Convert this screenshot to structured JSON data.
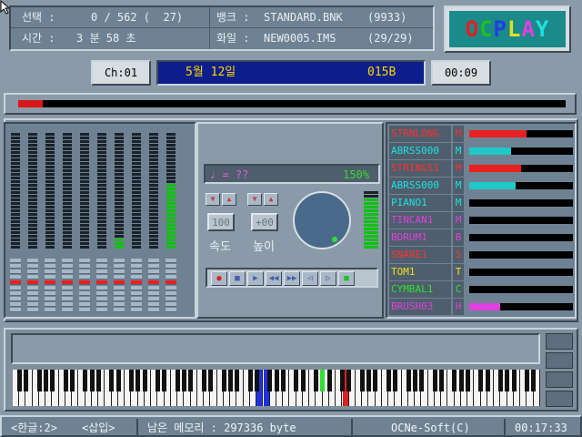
{
  "header": {
    "select_label": "선택 :",
    "select_value": "0 / 562 (  27)",
    "time_label": "시간 :",
    "time_value": "3 분 58 초",
    "bank_label": "뱅크 :",
    "bank_value": "STANDARD.BNK",
    "bank_count": "(9933)",
    "file_label": "화일 :",
    "file_value": "NEW0005.IMS",
    "file_count": "(29/29)"
  },
  "logo": {
    "letters": [
      "O",
      "C",
      "P",
      "L",
      "A",
      "Y"
    ],
    "colors": [
      "#e02020",
      "#20c020",
      "#2040e0",
      "#e0e020",
      "#e040e0",
      "#20e0e0"
    ]
  },
  "channel": "Ch:01",
  "date": "5월 12일",
  "code": "015B",
  "elapsed": "00:09",
  "progress": 0.045,
  "controls": {
    "tempo_display": "♩ = ??",
    "percent": "150%",
    "speed_value": "100",
    "pitch_value": "+00",
    "speed_label": "속도",
    "pitch_label": "높이",
    "dial_level": 0.62
  },
  "instruments": [
    {
      "name": "STRNLONG",
      "flag": "M",
      "name_color": "#ff3030",
      "flag_color": "#ff3030",
      "bar_color": "#e82020",
      "level": 0.55
    },
    {
      "name": "ABRSS000",
      "flag": "M",
      "name_color": "#20e0e0",
      "flag_color": "#20e0e0",
      "bar_color": "#20c8c8",
      "level": 0.4
    },
    {
      "name": "STRINGS1",
      "flag": "M",
      "name_color": "#ff3030",
      "flag_color": "#ff3030",
      "bar_color": "#e82020",
      "level": 0.5
    },
    {
      "name": "ABRSS000",
      "flag": "M",
      "name_color": "#20e0e0",
      "flag_color": "#20e0e0",
      "bar_color": "#20c8c8",
      "level": 0.45
    },
    {
      "name": "PIANO1",
      "flag": "M",
      "name_color": "#20e0e0",
      "flag_color": "#20e0e0",
      "bar_color": "#20c8c8",
      "level": 0
    },
    {
      "name": "TINCAN1",
      "flag": "M",
      "name_color": "#e040e0",
      "flag_color": "#e040e0",
      "bar_color": "#e040e0",
      "level": 0
    },
    {
      "name": "BDRUM1",
      "flag": "B",
      "name_color": "#e040e0",
      "flag_color": "#e040e0",
      "bar_color": "#e040e0",
      "level": 0
    },
    {
      "name": "SNARE1",
      "flag": "S",
      "name_color": "#ff3030",
      "flag_color": "#ff3030",
      "bar_color": "#e82020",
      "level": 0
    },
    {
      "name": "TOM1",
      "flag": "T",
      "name_color": "#f0e020",
      "flag_color": "#f0e020",
      "bar_color": "#f0e020",
      "level": 0
    },
    {
      "name": "CYMBAL1",
      "flag": "C",
      "name_color": "#30e030",
      "flag_color": "#30e030",
      "bar_color": "#30e030",
      "level": 0
    },
    {
      "name": "BRUSH03",
      "flag": "H",
      "name_color": "#e040e0",
      "flag_color": "#e040e0",
      "bar_color": "#e040e0",
      "level": 0.3
    }
  ],
  "vu_levels": [
    0,
    0,
    0,
    0,
    0,
    0,
    0.08,
    0,
    0,
    0.55
  ],
  "status": {
    "hangul_mode": "<한글:2>",
    "insert_mode": "<삽입>",
    "memory": "남은 메모리 : 297336 byte",
    "brand": "OCNe-Soft(C)",
    "clock": "00:17:33"
  }
}
